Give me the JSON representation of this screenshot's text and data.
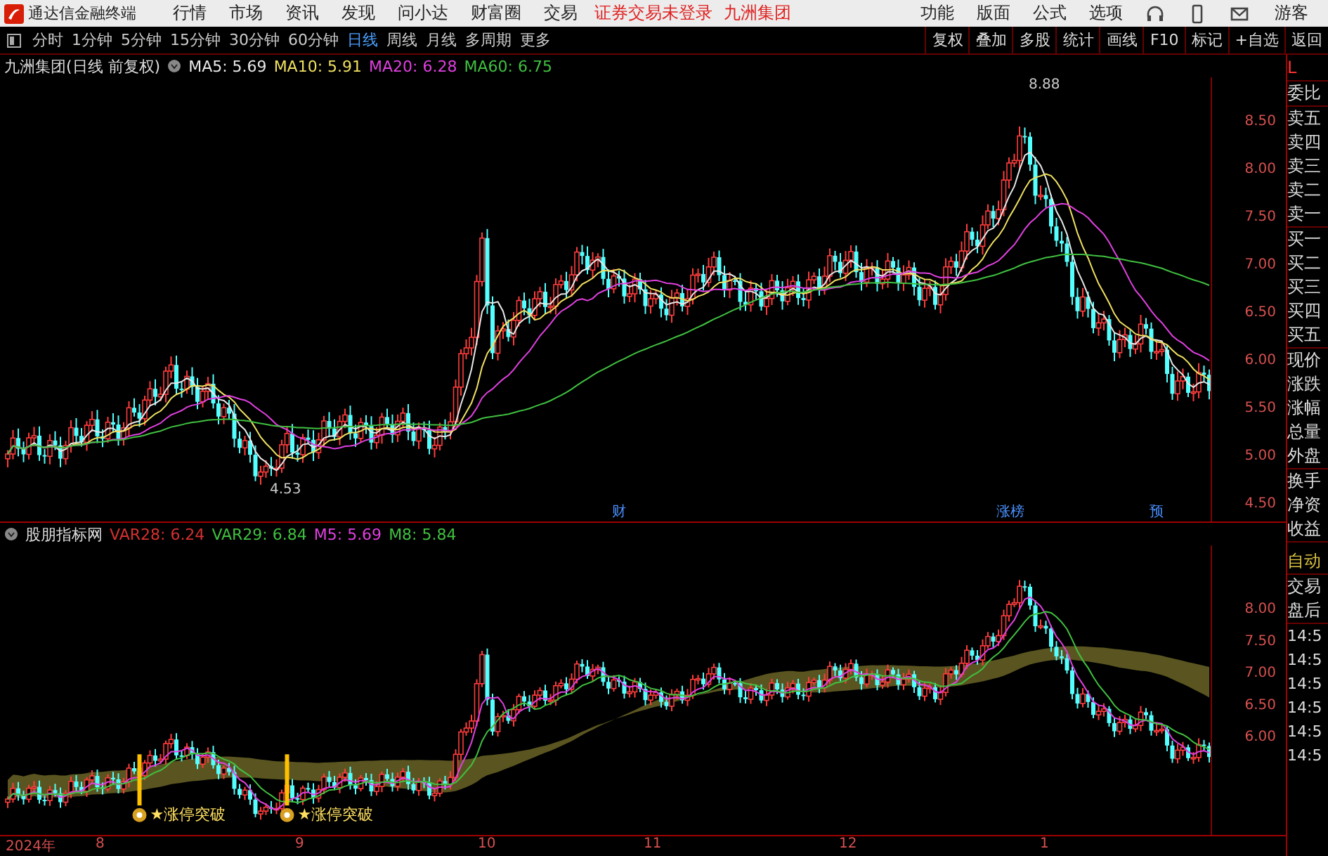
{
  "app_bar": {
    "title": "通达信金融终端",
    "menu": [
      "行情",
      "市场",
      "资讯",
      "发现",
      "问小达",
      "财富圈",
      "交易"
    ],
    "status": "证券交易未登录",
    "stock": "九洲集团",
    "right_menu": [
      "功能",
      "版面",
      "公式",
      "选项"
    ],
    "user": "游客"
  },
  "toolbar": {
    "periods": [
      {
        "label": "分时",
        "selected": false
      },
      {
        "label": "1分钟",
        "selected": false
      },
      {
        "label": "5分钟",
        "selected": false
      },
      {
        "label": "15分钟",
        "selected": false
      },
      {
        "label": "30分钟",
        "selected": false
      },
      {
        "label": "60分钟",
        "selected": false
      },
      {
        "label": "日线",
        "selected": true
      },
      {
        "label": "周线",
        "selected": false
      },
      {
        "label": "月线",
        "selected": false
      },
      {
        "label": "多周期",
        "selected": false
      },
      {
        "label": "更多",
        "selected": false
      }
    ],
    "buttons": [
      "复权",
      "叠加",
      "多股",
      "统计",
      "画线",
      "F10",
      "标记",
      "+自选",
      "返回"
    ]
  },
  "main_chart": {
    "title": "九洲集团(日线 前复权)",
    "legend": [
      {
        "label": "MA5: 5.69",
        "color": "#e8e8e8"
      },
      {
        "label": "MA10: 5.91",
        "color": "#f0e060"
      },
      {
        "label": "MA20: 6.28",
        "color": "#e040e0"
      },
      {
        "label": "MA60: 6.75",
        "color": "#40c040"
      }
    ],
    "price_axis": [
      "8.50",
      "8.00",
      "7.50",
      "7.00",
      "6.50",
      "6.00",
      "5.50",
      "5.00",
      "4.50"
    ],
    "high_label": "8.88",
    "low_label": "4.53",
    "events": [
      "财",
      "涨榜",
      "预"
    ]
  },
  "indicator": {
    "title": "股朋指标网",
    "legend": [
      {
        "label": "VAR28: 6.24",
        "color": "#d83030"
      },
      {
        "label": "VAR29: 6.84",
        "color": "#40c040"
      },
      {
        "label": "M5: 5.69",
        "color": "#e040e0"
      },
      {
        "label": "M8: 5.84",
        "color": "#40c040"
      }
    ],
    "price_axis": [
      "8.00",
      "7.50",
      "7.00",
      "6.50",
      "6.00"
    ],
    "signals": [
      "★涨停突破",
      "★涨停突破"
    ]
  },
  "date_axis": [
    "2024年",
    "8",
    "9",
    "10",
    "11",
    "12",
    "1"
  ],
  "side_panel": {
    "header": "L",
    "groups": [
      [
        "委比"
      ],
      [
        "卖五",
        "卖四",
        "卖三",
        "卖二",
        "卖一"
      ],
      [
        "买一",
        "买二",
        "买三",
        "买四",
        "买五"
      ],
      [
        "现价",
        "涨跌",
        "涨幅",
        "总量",
        "外盘"
      ],
      [
        "换手",
        "净资",
        "收益"
      ]
    ],
    "mode": "自动",
    "trade_labels": [
      "交易",
      "盘后"
    ],
    "times": [
      "14:5",
      "14:5",
      "14:5",
      "14:5",
      "14:5",
      "14:5"
    ]
  }
}
